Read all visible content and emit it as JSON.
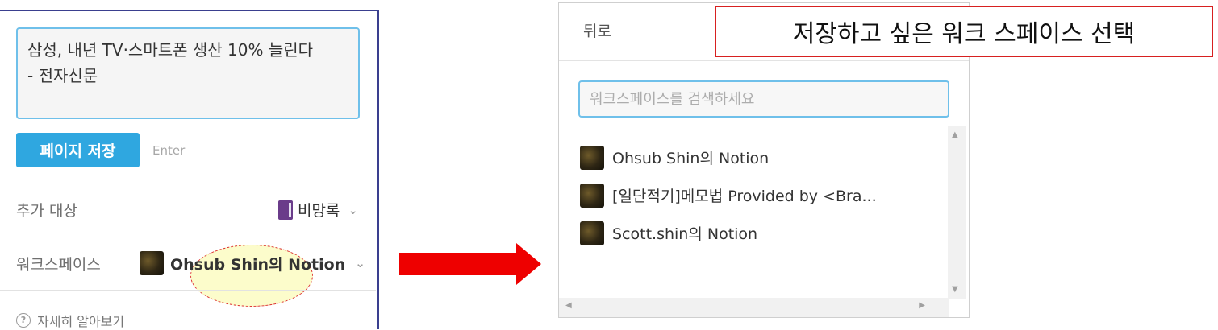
{
  "clipper": {
    "title_line1": "삼성, 내년 TV·스마트폰 생산 10% 늘린다",
    "title_line2": "- 전자신문",
    "save_button": "페이지 저장",
    "enter_hint": "Enter",
    "add_target_label": "추가 대상",
    "add_target_value": "비망록",
    "workspace_label": "워크스페이스",
    "workspace_value": "Ohsub Shin의 Notion",
    "help_text": "자세히 알아보기"
  },
  "picker": {
    "back_label": "뒤로",
    "search_placeholder": "워크스페이스를 검색하세요",
    "workspaces": [
      {
        "name": "Ohsub Shin의 Notion"
      },
      {
        "name": "[일단적기]메모법 Provided by <Bra..."
      },
      {
        "name": "Scott.shin의 Notion"
      }
    ]
  },
  "caption": "저장하고 싶은 워크 스페이스 선택",
  "colors": {
    "accent": "#2fa7e0",
    "input_border": "#6fc0ea",
    "arrow": "#ee0000",
    "caption_border": "#d72020",
    "highlight_fill": "#fafaa0"
  },
  "icons": {
    "book": "book-icon",
    "chevron": "chevron-down-icon",
    "help": "question-circle-icon",
    "arrow": "arrow-right-icon"
  }
}
